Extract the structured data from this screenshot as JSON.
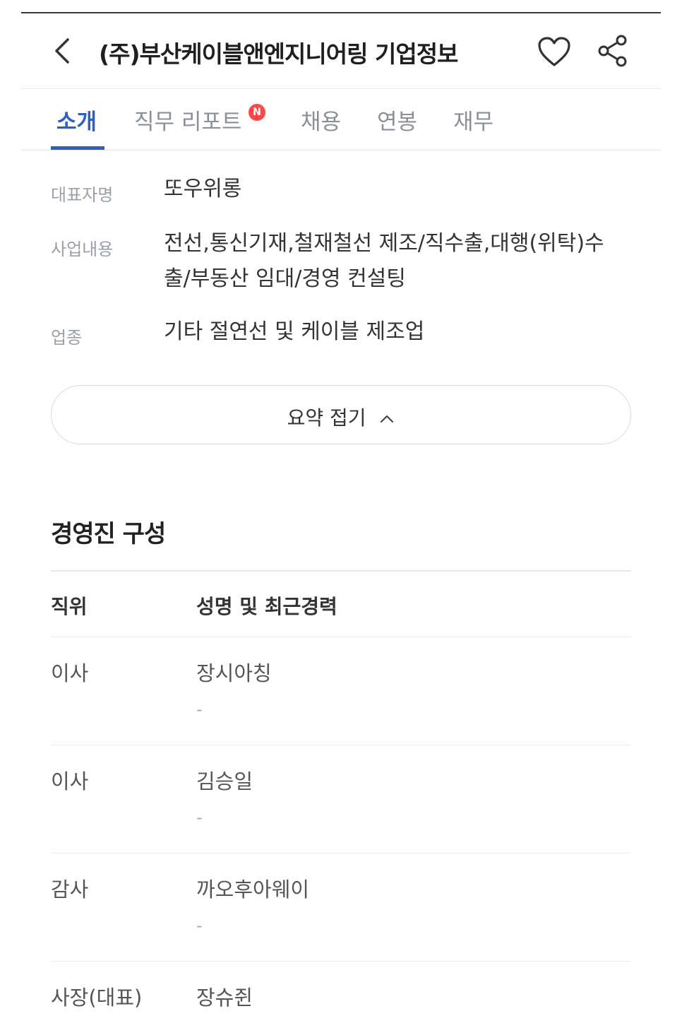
{
  "header": {
    "title": "(주)부산케이블앤엔지니어링 기업정보",
    "back_icon": "chevron-left-icon",
    "favorite_icon": "heart-icon",
    "share_icon": "share-icon"
  },
  "tabs": [
    {
      "label": "소개",
      "active": true
    },
    {
      "label": "직무 리포트",
      "badge": "N"
    },
    {
      "label": "채용"
    },
    {
      "label": "연봉"
    },
    {
      "label": "재무"
    }
  ],
  "summary": {
    "ceo_label": "대표자명",
    "ceo_value": "또우위롱",
    "business_label": "사업내용",
    "business_value": "전선,통신기재,철재철선 제조/직수출,대행(위탁)수출/부동산 임대/경영 컨설팅",
    "industry_label": "업종",
    "industry_value": "기타 절연선 및 케이블 제조업",
    "collapse_label": "요약 접기"
  },
  "management": {
    "title": "경영진 구성",
    "col_position": "직위",
    "col_name": "성명 및 최근경력",
    "rows": [
      {
        "position": "이사",
        "name": "장시아칭",
        "career": "-"
      },
      {
        "position": "이사",
        "name": "김승일",
        "career": "-"
      },
      {
        "position": "감사",
        "name": "까오후아웨이",
        "career": "-"
      },
      {
        "position": "사장(대표)",
        "name": "장슈쥔",
        "career": ""
      }
    ]
  },
  "colors": {
    "accent": "#2b5fc2",
    "badge": "#ff4545"
  }
}
